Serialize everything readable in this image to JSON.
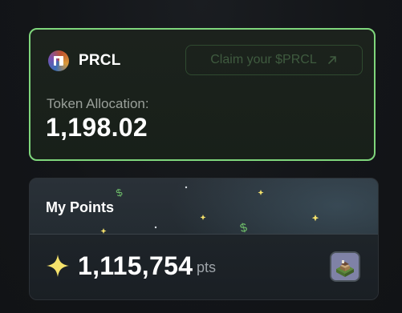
{
  "token_card": {
    "name": "PRCL",
    "logo_icon": "prcl-logo-icon",
    "claim_label": "Claim your $PRCL",
    "claim_icon": "arrow-up-right-icon",
    "allocation_label": "Token Allocation:",
    "allocation_value": "1,198.02",
    "accent_color": "#7fd67c"
  },
  "points_card": {
    "title": "My Points",
    "value": "1,115,754",
    "unit": "pts",
    "value_icon": "sparkle-icon",
    "avatar_icon": "building-avatar-icon",
    "sparkle_color": "#f5e26b",
    "dollar_color": "#6fbf6a"
  }
}
